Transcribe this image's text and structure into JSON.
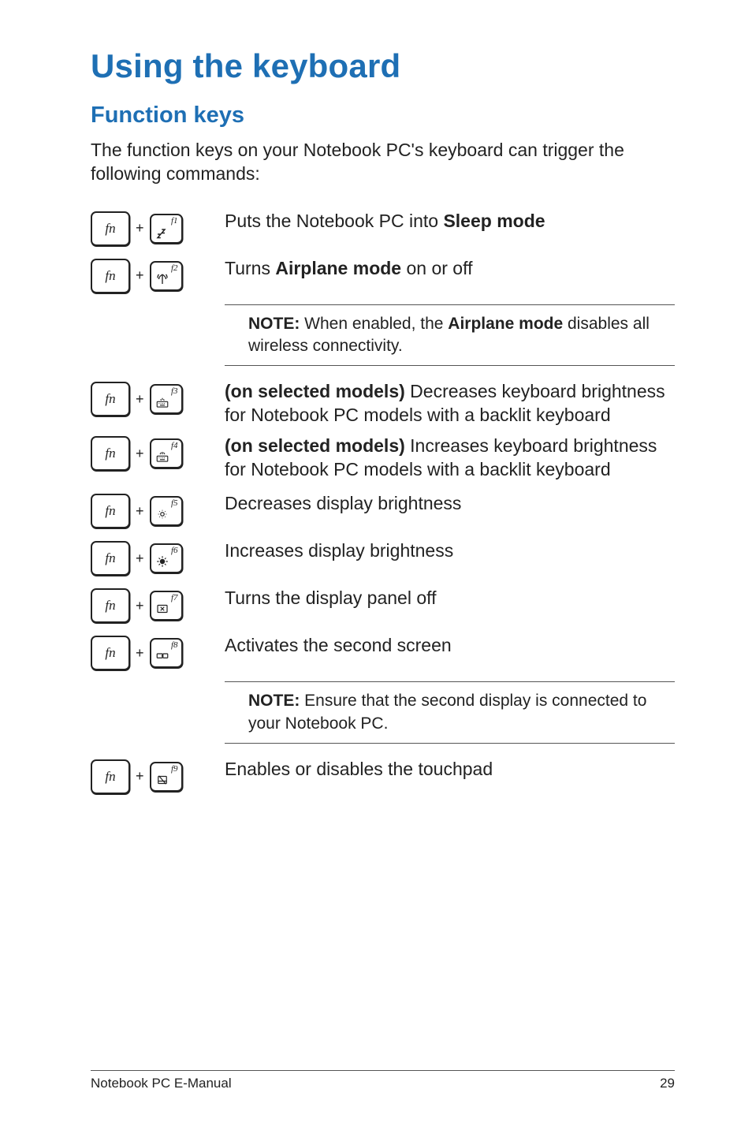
{
  "title": "Using the keyboard",
  "section": "Function keys",
  "intro": "The function keys on your Notebook PC's keyboard can trigger the following commands:",
  "fn_label": "fn",
  "rows": {
    "f1": {
      "f": "f1",
      "desc_prefix": "Puts the Notebook PC into ",
      "desc_bold": "Sleep mode",
      "desc_suffix": ""
    },
    "f2": {
      "f": "f2",
      "desc_prefix": "Turns ",
      "desc_bold": "Airplane mode",
      "desc_suffix": " on or off"
    },
    "f3": {
      "f": "f3",
      "desc_bold": "(on selected models)",
      "desc_suffix": " Decreases keyboard brightness for Notebook PC models with a backlit keyboard"
    },
    "f4": {
      "f": "f4",
      "desc_bold": "(on selected models)",
      "desc_suffix": " Increases keyboard brightness for Notebook PC models with a backlit keyboard"
    },
    "f5": {
      "f": "f5",
      "desc": "Decreases display brightness"
    },
    "f6": {
      "f": "f6",
      "desc": "Increases display brightness"
    },
    "f7": {
      "f": "f7",
      "desc": "Turns the display panel off"
    },
    "f8": {
      "f": "f8",
      "desc": "Activates the second screen"
    },
    "f9": {
      "f": "f9",
      "desc": "Enables or disables the touchpad"
    }
  },
  "notes": {
    "airplane": {
      "bold1": "NOTE:",
      "mid": " When enabled, the ",
      "bold2": "Airplane mode",
      "tail": " disables all wireless connectivity."
    },
    "second": {
      "bold1": "NOTE:",
      "tail": " Ensure that the second display is connected to your Notebook PC."
    }
  },
  "footer": {
    "left": "Notebook PC E-Manual",
    "right": "29"
  }
}
